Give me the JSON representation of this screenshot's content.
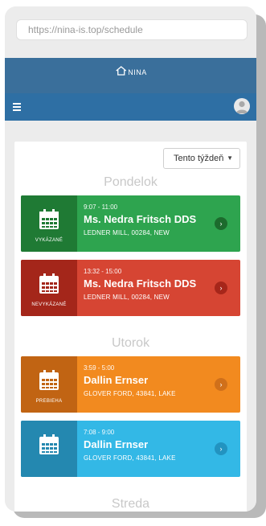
{
  "browser": {
    "url": "https://nina-is.top/schedule"
  },
  "header": {
    "brand": "NINA"
  },
  "filter": {
    "week_selected": "Tento týždeň"
  },
  "days": [
    {
      "label": "Pondelok",
      "events": [
        {
          "time": "9:07 - 11:00",
          "name": "Ms. Nedra Fritsch DDS",
          "address": "LEDNER MILL, 00284, NEW",
          "status": "VYKÁZANÉ",
          "color": "#2ea44f"
        },
        {
          "time": "13:32 - 15:00",
          "name": "Ms. Nedra Fritsch DDS",
          "address": "LEDNER MILL, 00284, NEW",
          "status": "NEVYKÁZANÉ",
          "color": "#d64533"
        }
      ]
    },
    {
      "label": "Utorok",
      "events": [
        {
          "time": "3:59 - 5:00",
          "name": "Dallin Ernser",
          "address": "GLOVER FORD, 43841, LAKE",
          "status": "PREBIEHA",
          "color": "#f28a1f"
        },
        {
          "time": "7:08 - 9:00",
          "name": "Dallin Ernser",
          "address": "GLOVER FORD, 43841, LAKE",
          "status": "",
          "color": "#33b8e6"
        }
      ]
    },
    {
      "label": "Streda",
      "events": []
    }
  ]
}
